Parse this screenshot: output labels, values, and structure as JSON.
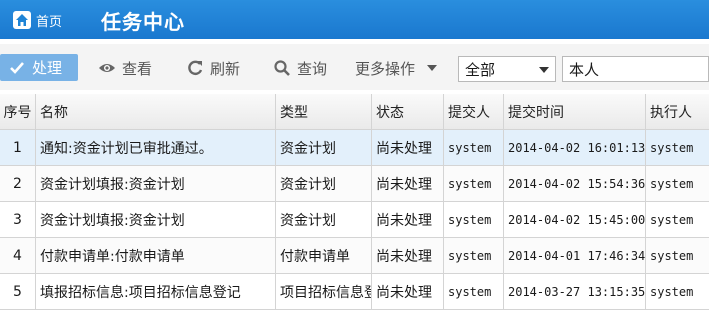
{
  "header": {
    "home_label": "首页",
    "title": "任务中心"
  },
  "toolbar": {
    "process_label": "处理",
    "view_label": "查看",
    "refresh_label": "刷新",
    "search_label": "查询",
    "more_label": "更多操作",
    "scope_select_value": "全部",
    "owner_input_value": "本人"
  },
  "colors": {
    "header_bg": "#1f84d6",
    "primary_button_bg": "#78b2e6",
    "selected_row_bg": "#e3f0fb"
  },
  "table": {
    "columns": [
      "序号",
      "名称",
      "类型",
      "状态",
      "提交人",
      "提交时间",
      "执行人"
    ],
    "rows": [
      [
        "1",
        "通知:资金计划已审批通过。",
        "资金计划",
        "尚未处理",
        "system",
        "2014-04-02 16:01:13",
        "system"
      ],
      [
        "2",
        "资金计划填报:资金计划",
        "资金计划",
        "尚未处理",
        "system",
        "2014-04-02 15:54:36",
        "system"
      ],
      [
        "3",
        "资金计划填报:资金计划",
        "资金计划",
        "尚未处理",
        "system",
        "2014-04-02 15:45:00",
        "system"
      ],
      [
        "4",
        "付款申请单:付款申请单",
        "付款申请单",
        "尚未处理",
        "system",
        "2014-04-01 17:46:34",
        "system"
      ],
      [
        "5",
        "填报招标信息:项目招标信息登记",
        "项目招标信息登记",
        "尚未处理",
        "system",
        "2014-03-27 13:15:35",
        "system"
      ]
    ]
  }
}
